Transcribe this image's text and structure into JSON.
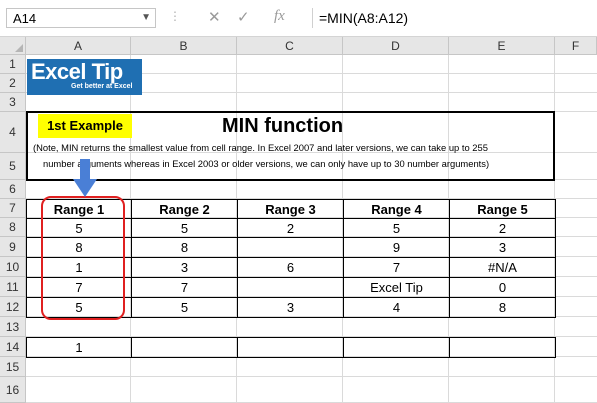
{
  "formula_bar": {
    "name_box": "A14",
    "cancel_icon": "✕",
    "enter_icon": "✓",
    "fx_icon": "fx",
    "formula": "=MIN(A8:A12)"
  },
  "columns": [
    "A",
    "B",
    "C",
    "D",
    "E",
    "F"
  ],
  "rows": [
    "1",
    "2",
    "3",
    "4",
    "5",
    "6",
    "7",
    "8",
    "9",
    "10",
    "11",
    "12",
    "13",
    "14",
    "15",
    "16"
  ],
  "logo": {
    "word1": "Excel",
    "word2": "Tip",
    "tagline": "Get better at Excel"
  },
  "example_badge": "1st Example",
  "title": "MIN function",
  "note_line1": "(Note, MIN returns the smallest value from cell range. In Excel 2007 and later versions, we can take up to 255",
  "note_line2": "number arguments whereas in Excel 2003 or older versions, we can only have up to 30 number arguments)",
  "table": {
    "headers": [
      "Range 1",
      "Range 2",
      "Range 3",
      "Range 4",
      "Range 5"
    ],
    "rows": [
      [
        "5",
        "5",
        "2",
        "5",
        "2"
      ],
      [
        "8",
        "8",
        "",
        "9",
        "3"
      ],
      [
        "1",
        "3",
        "6",
        "7",
        "#N/A"
      ],
      [
        "7",
        "7",
        "",
        "Excel Tip",
        "0"
      ],
      [
        "5",
        "5",
        "3",
        "4",
        "8"
      ]
    ]
  },
  "result_row": [
    "1",
    "",
    "",
    "",
    ""
  ],
  "colors": {
    "accent_red": "#e02020",
    "arrow_blue": "#4a7fd6",
    "logo_blue": "#1f6fb2",
    "badge_yellow": "#ffff00"
  }
}
